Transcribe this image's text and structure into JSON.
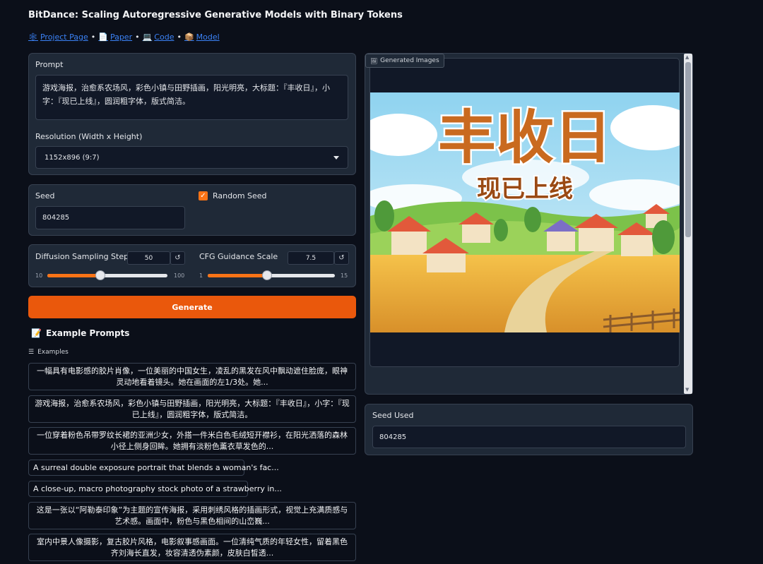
{
  "app": {
    "title": "BitDance: Scaling Autoregressive Generative Models with Binary Tokens",
    "links": [
      {
        "label": "Project Page",
        "icon": "🕸"
      },
      {
        "label": "Paper",
        "icon": "📄"
      },
      {
        "label": "Code",
        "icon": "💻"
      },
      {
        "label": "Model",
        "icon": "📦"
      }
    ],
    "link_separator": "•"
  },
  "prompt": {
    "label": "Prompt",
    "value": "游戏海报，治愈系农场风，彩色小镇与田野插画，阳光明亮，大标题：『丰收日』，小字：『现已上线』，圆润粗字体，版式简洁。"
  },
  "resolution": {
    "label": "Resolution (Width x Height)",
    "value": "1152x896 (9:7)"
  },
  "seed": {
    "label": "Seed",
    "value": "804285",
    "random_label": "Random Seed",
    "random_checked": true
  },
  "steps": {
    "label": "Diffusion Sampling Steps",
    "value": "50",
    "min": "10",
    "max": "100",
    "fraction": 0.444
  },
  "cfg": {
    "label": "CFG Guidance Scale",
    "value": "7.5",
    "min": "1",
    "max": "15",
    "fraction": 0.464
  },
  "reset_icon": "↺",
  "generate_label": "Generate",
  "examples": {
    "heading": "Example Prompts",
    "heading_icon": "📝",
    "sub_label": "Examples",
    "sub_icon": "☰",
    "items": [
      "一幅具有电影感的胶片肖像，一位美丽的中国女生，凌乱的黑发在风中飘动遮住脸庞，眼神灵动地看着镜头。她在画面的左1/3处。她...",
      "游戏海报，治愈系农场风，彩色小镇与田野插画，阳光明亮，大标题：『丰收日』，小字：『现已上线』，圆润粗字体，版式简洁。",
      "一位穿着粉色吊带罗纹长裙的亚洲少女，外搭一件米白色毛绒短开襟衫，在阳光洒落的森林小径上侧身回眸。她拥有淡粉色薰衣草发色的...",
      "A surreal double exposure portrait that blends a woman's fac...",
      "A close-up, macro photography stock photo of a strawberry in...",
      "这是一张以“阿勒泰印象”为主题的宣传海报，采用刺绣风格的插画形式，视觉上充满质感与艺术感。画面中，粉色与黑色相间的山峦巍...",
      "室内中景人像摄影，复古胶片风格，电影叙事感画面。一位清纯气质的年轻女性，留着黑色齐刘海长直发，妆容清透伪素颜，皮肤白皙透..."
    ]
  },
  "output": {
    "tab_label": "Generated Images",
    "tab_icon": "🖼",
    "poster_title": "丰收日",
    "poster_subtitle": "现已上线"
  },
  "seed_used": {
    "label": "Seed Used",
    "value": "804285"
  }
}
